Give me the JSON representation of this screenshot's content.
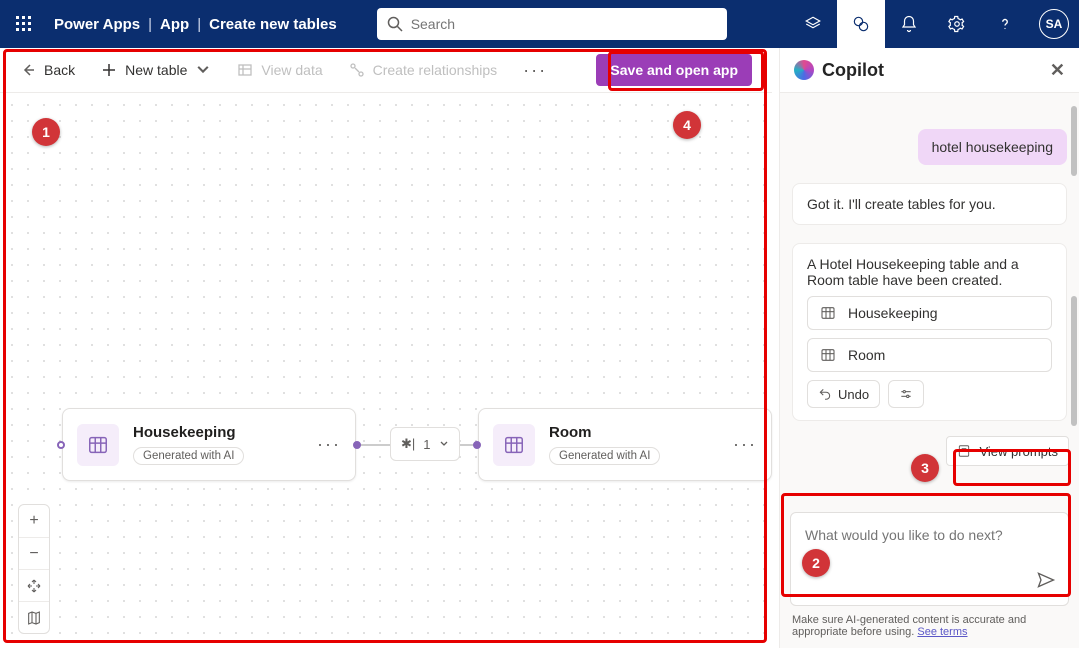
{
  "header": {
    "appName": "Power Apps",
    "crumbs": [
      "App",
      "Create new tables"
    ],
    "searchPlaceholder": "Search",
    "avatarInitials": "SA"
  },
  "commandbar": {
    "back": "Back",
    "newTable": "New table",
    "viewData": "View data",
    "createRel": "Create relationships",
    "saveOpen": "Save and open app"
  },
  "canvas": {
    "tables": [
      {
        "name": "Housekeeping",
        "chip": "Generated with AI"
      },
      {
        "name": "Room",
        "chip": "Generated with AI"
      }
    ],
    "relLabel": "1"
  },
  "copilot": {
    "title": "Copilot",
    "userMessage": "hotel housekeeping",
    "botMessage1": "Got it. I'll create tables for you.",
    "botMessage2": "A Hotel Housekeeping table and a Room table have been created.",
    "tableLinks": [
      "Housekeeping",
      "Room"
    ],
    "undo": "Undo",
    "viewPrompts": "View prompts",
    "inputPlaceholder": "What would you like to do next?",
    "disclaimerPrefix": "Make sure AI-generated content is accurate and appropriate before using. ",
    "disclaimerLink": "See terms"
  },
  "callouts": {
    "c1": "1",
    "c2": "2",
    "c3": "3",
    "c4": "4"
  }
}
